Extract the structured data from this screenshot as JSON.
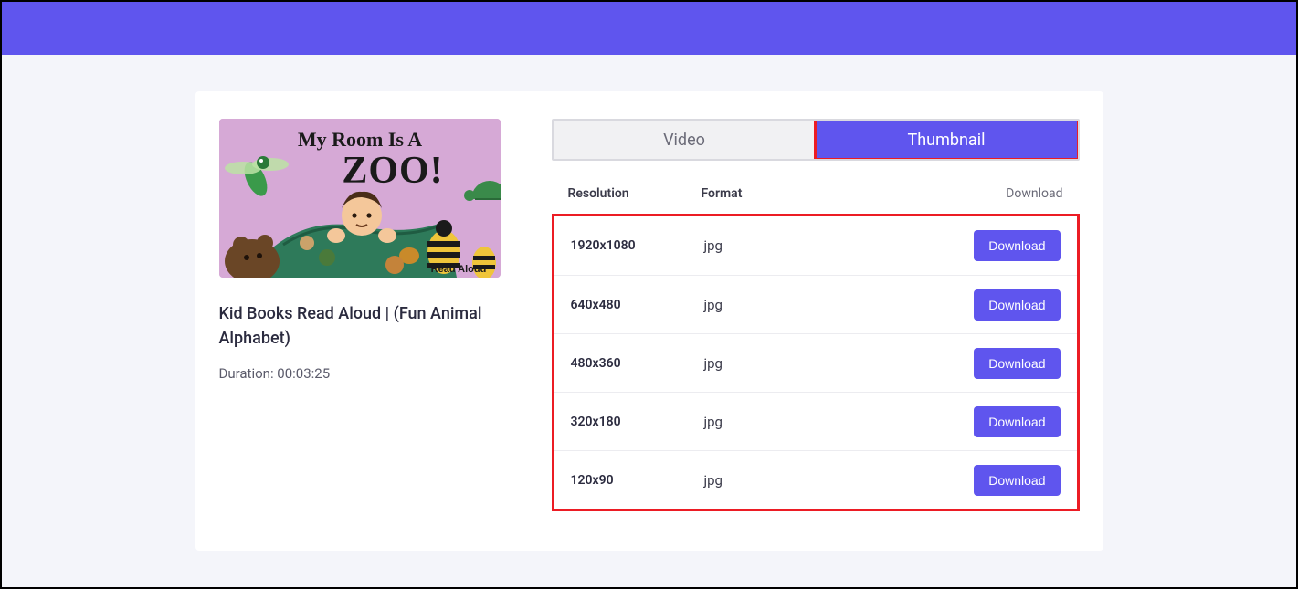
{
  "video": {
    "title": "Kid Books Read Aloud | (Fun Animal Alphabet)",
    "duration_label": "Duration: 00:03:25",
    "thumbnail_text_top": "My Room Is A",
    "thumbnail_text_big": "ZOO!",
    "thumbnail_badge": "Read Aloud"
  },
  "tabs": {
    "video": "Video",
    "thumbnail": "Thumbnail",
    "active": "thumbnail"
  },
  "columns": {
    "resolution": "Resolution",
    "format": "Format",
    "download": "Download"
  },
  "download_button_label": "Download",
  "thumbnails": [
    {
      "resolution": "1920x1080",
      "format": "jpg"
    },
    {
      "resolution": "640x480",
      "format": "jpg"
    },
    {
      "resolution": "480x360",
      "format": "jpg"
    },
    {
      "resolution": "320x180",
      "format": "jpg"
    },
    {
      "resolution": "120x90",
      "format": "jpg"
    }
  ],
  "colors": {
    "accent": "#5f55ee",
    "highlight": "#ec1c24",
    "page_bg": "#f4f5fa"
  }
}
